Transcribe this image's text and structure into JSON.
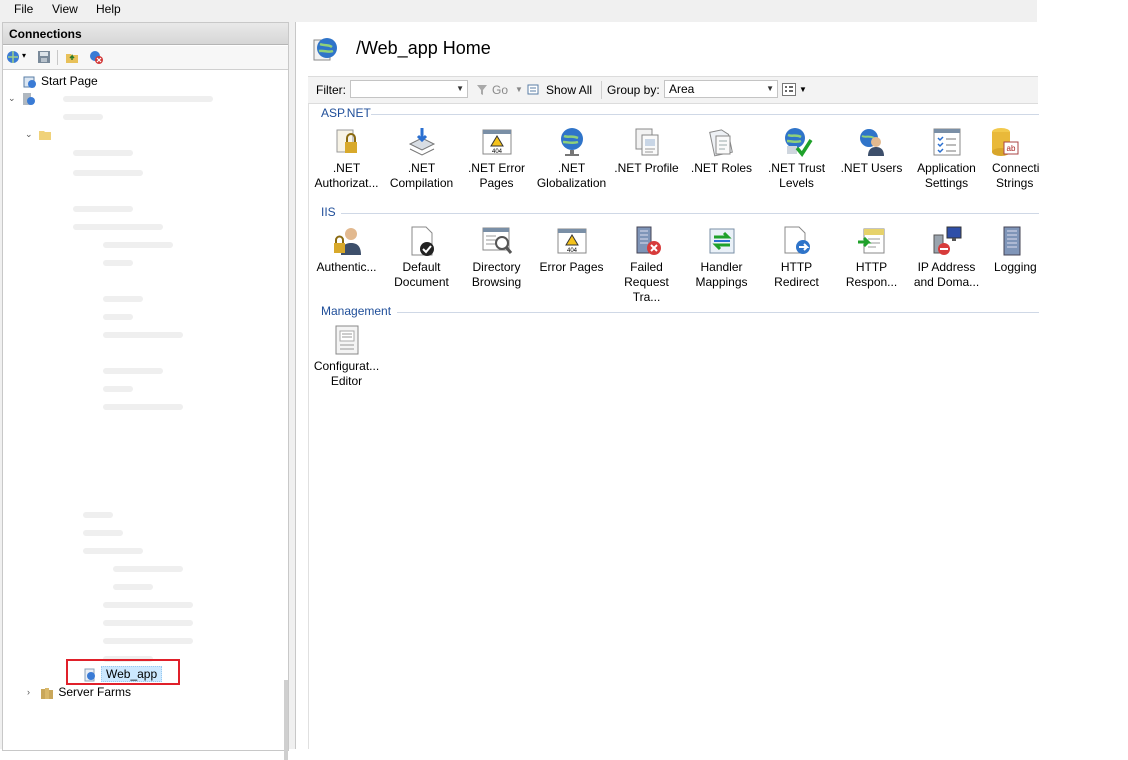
{
  "menu": [
    "File",
    "View",
    "Help"
  ],
  "connections": {
    "title": "Connections",
    "tree": {
      "start_page": "Start Page",
      "selected_site": "Web_app",
      "server_farms": "Server Farms"
    }
  },
  "main": {
    "title": "/Web_app Home",
    "filter": {
      "filter_label": "Filter:",
      "filter_value": "",
      "go_label": "Go",
      "show_all_label": "Show All",
      "group_by_label": "Group by:",
      "group_by_value": "Area"
    },
    "sections": [
      {
        "name": "ASP.NET",
        "features": [
          {
            "line1": ".NET",
            "line2": "Authorizat...",
            "icon": "net-authorization-icon"
          },
          {
            "line1": ".NET",
            "line2": "Compilation",
            "icon": "net-compilation-icon"
          },
          {
            "line1": ".NET Error",
            "line2": "Pages",
            "icon": "net-error-pages-icon"
          },
          {
            "line1": ".NET",
            "line2": "Globalization",
            "icon": "net-globalization-icon"
          },
          {
            "line1": ".NET Profile",
            "line2": "",
            "icon": "net-profile-icon"
          },
          {
            "line1": ".NET Roles",
            "line2": "",
            "icon": "net-roles-icon"
          },
          {
            "line1": ".NET Trust",
            "line2": "Levels",
            "icon": "net-trust-levels-icon"
          },
          {
            "line1": ".NET Users",
            "line2": "",
            "icon": "net-users-icon"
          },
          {
            "line1": "Application",
            "line2": "Settings",
            "icon": "application-settings-icon"
          },
          {
            "line1": "Connecti",
            "line2": "Strings",
            "icon": "connection-strings-icon"
          }
        ]
      },
      {
        "name": "IIS",
        "features": [
          {
            "line1": "Authentic...",
            "line2": "",
            "icon": "authentication-icon"
          },
          {
            "line1": "Default",
            "line2": "Document",
            "icon": "default-document-icon"
          },
          {
            "line1": "Directory",
            "line2": "Browsing",
            "icon": "directory-browsing-icon"
          },
          {
            "line1": "Error Pages",
            "line2": "",
            "icon": "error-pages-icon"
          },
          {
            "line1": "Failed",
            "line2": "Request Tra...",
            "icon": "failed-request-tracing-icon"
          },
          {
            "line1": "Handler",
            "line2": "Mappings",
            "icon": "handler-mappings-icon"
          },
          {
            "line1": "HTTP",
            "line2": "Redirect",
            "icon": "http-redirect-icon"
          },
          {
            "line1": "HTTP",
            "line2": "Respon...",
            "icon": "http-response-headers-icon"
          },
          {
            "line1": "IP Address",
            "line2": "and Doma...",
            "icon": "ip-address-domain-icon"
          },
          {
            "line1": "Logging",
            "line2": "",
            "icon": "logging-icon"
          }
        ]
      },
      {
        "name": "Management",
        "features": [
          {
            "line1": "Configurat...",
            "line2": "Editor",
            "icon": "configuration-editor-icon"
          }
        ]
      }
    ]
  }
}
